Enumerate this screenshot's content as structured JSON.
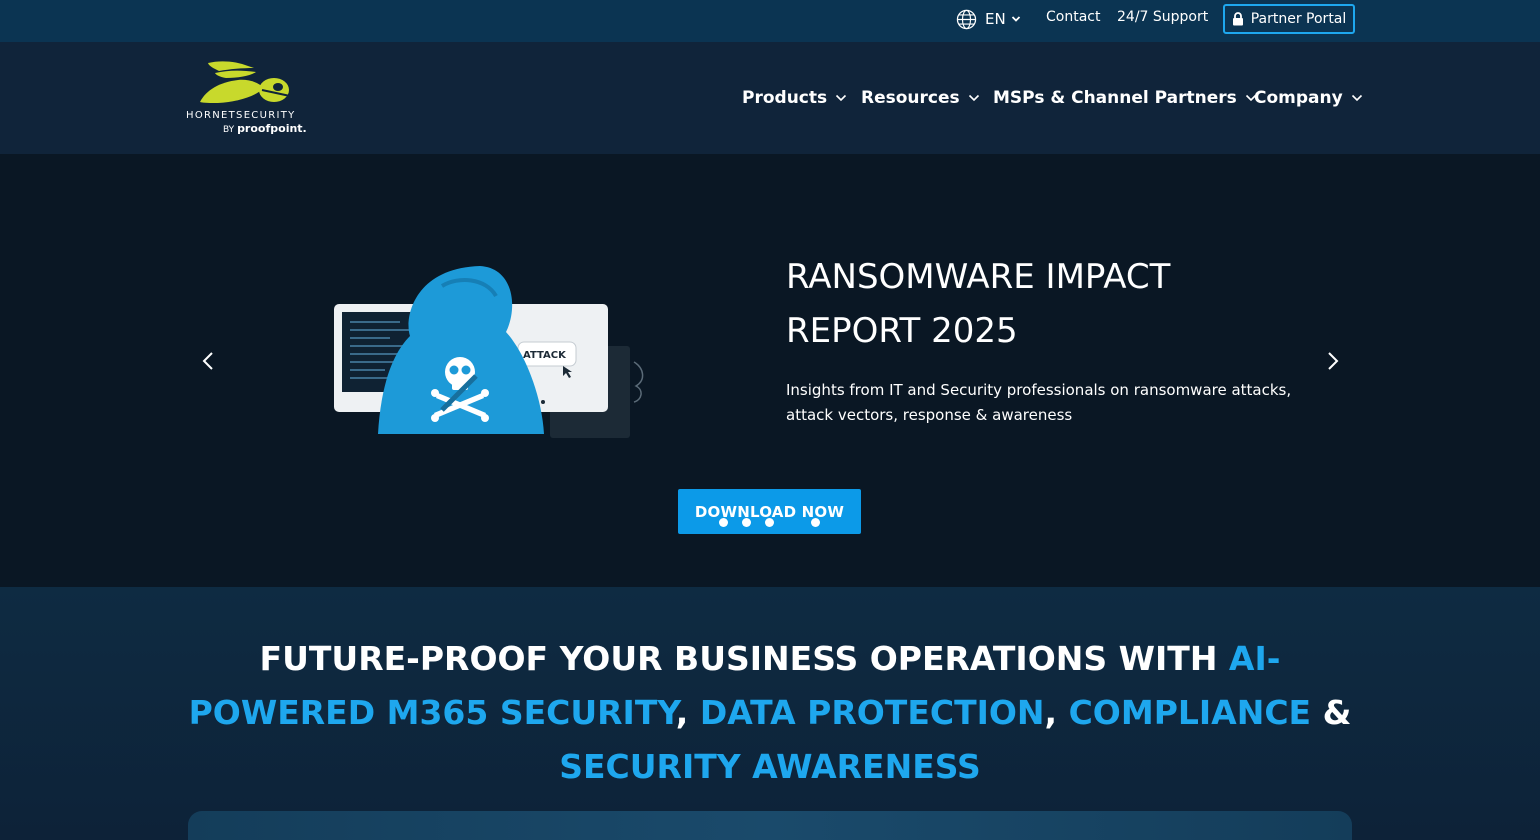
{
  "topbar": {
    "language": "EN",
    "contact": "Contact",
    "support": "24/7 Support",
    "partner_portal": "Partner Portal"
  },
  "header": {
    "logo_name": "HORNETSECURITY",
    "logo_by": "BY",
    "logo_parent": "proofpoint.",
    "nav": {
      "products": "Products",
      "resources": "Resources",
      "partners": "MSPs & Channel Partners",
      "company": "Company"
    }
  },
  "hero": {
    "title_line1": "RANSOMWARE IMPACT",
    "title_line2": "REPORT 2025",
    "description": "Insights from IT and Security professionals on ransomware attacks, attack vectors, response & awareness",
    "illustration_label": "ATTACK",
    "cta": "DOWNLOAD NOW",
    "slide_count": 4
  },
  "section": {
    "headline_1": "FUTURE-PROOF YOUR BUSINESS OPERATIONS WITH ",
    "headline_2": "AI-POWERED M365 SECURITY",
    "headline_3": ", ",
    "headline_4": "DATA PROTECTION",
    "headline_5": ", ",
    "headline_6": "COMPLIANCE",
    "headline_7": " & ",
    "headline_8": "SECURITY AWARENESS"
  },
  "colors": {
    "accent": "#1ea7ee",
    "cta": "#0c9ae8",
    "topbar": "#0b3452",
    "header": "#10243a",
    "hero": "#0a1724",
    "logo_yellow": "#c8d92c"
  },
  "icons": {
    "globe": "globe-icon",
    "lock": "lock-icon",
    "chevron": "chevron-down-icon",
    "prev": "chevron-left-icon",
    "next": "chevron-right-icon"
  }
}
